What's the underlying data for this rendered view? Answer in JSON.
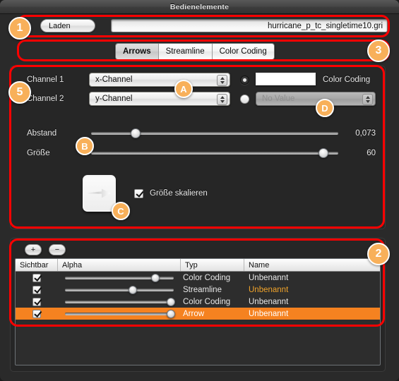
{
  "window": {
    "title": "Bedienelemente"
  },
  "toolbar": {
    "load_button": "Laden",
    "file_path": "hurricane_p_tc_singletime10.gri"
  },
  "tabs": [
    {
      "label": "Arrows",
      "selected": true
    },
    {
      "label": "Streamline",
      "selected": false
    },
    {
      "label": "Color Coding",
      "selected": false
    }
  ],
  "arrows_panel": {
    "channel1_label": "Channel 1",
    "channel1_value": "x-Channel",
    "channel2_label": "Channel 2",
    "channel2_value": "y-Channel",
    "color_coding_label": "Color Coding",
    "color_coding_radio_selected": true,
    "color_well_value": "#ffffff",
    "novalue_radio_selected": false,
    "novalue_value": "No Value",
    "novalue_disabled": true,
    "abstand_label": "Abstand",
    "abstand_value": "0,073",
    "abstand_percent": 18,
    "groesse_label": "Größe",
    "groesse_value": "60",
    "groesse_percent": 94,
    "scale_checkbox_label": "Größe skalieren",
    "scale_checkbox_checked": true,
    "preview_icon": "arrow-right-icon"
  },
  "layers_panel": {
    "add_button": "+",
    "remove_button": "−",
    "columns": [
      "Sichtbar",
      "Alpha",
      "Typ",
      "Name"
    ],
    "rows": [
      {
        "visible": true,
        "alpha_percent": 82,
        "typ": "Color Coding",
        "name": "Unbenannt",
        "name_highlight": false,
        "selected": false
      },
      {
        "visible": true,
        "alpha_percent": 62,
        "typ": "Streamline",
        "name": "Unbenannt",
        "name_highlight": true,
        "selected": false
      },
      {
        "visible": true,
        "alpha_percent": 96,
        "typ": "Color Coding",
        "name": "Unbenannt",
        "name_highlight": false,
        "selected": false
      },
      {
        "visible": true,
        "alpha_percent": 96,
        "typ": "Arrow",
        "name": "Unbenannt",
        "name_highlight": false,
        "selected": true
      }
    ]
  },
  "annotations": {
    "badges": [
      {
        "label": "1"
      },
      {
        "label": "2"
      },
      {
        "label": "3"
      },
      {
        "label": "5"
      },
      {
        "label": "A"
      },
      {
        "label": "B"
      },
      {
        "label": "C"
      },
      {
        "label": "D"
      }
    ],
    "highlight_color": "#ff0000",
    "badge_color": "#f8b05a"
  }
}
